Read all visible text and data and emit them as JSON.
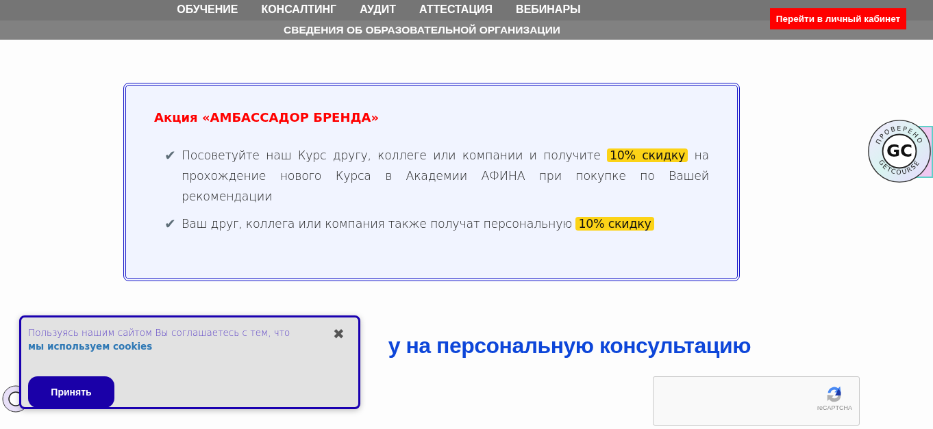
{
  "nav": {
    "items": [
      "ОБУЧЕНИЕ",
      "КОНСАЛТИНГ",
      "АУДИТ",
      "АТТЕСТАЦИЯ",
      "ВЕБИНАРЫ"
    ],
    "secondary": "СВЕДЕНИЯ ОБ ОБРАЗОВАТЕЛЬНОЙ ОРГАНИЗАЦИИ",
    "cabinet_button": "Перейти в личный кабинет"
  },
  "promo": {
    "title": "Акция «АМБАССАДОР БРЕНДА»",
    "items": [
      {
        "check": "✔",
        "text": "Посоветуйте наш Курс другу, коллеге или компании и получите **10% скидку** на прохождение нового Курса в Академии АФИНА при покупке по Вашей рекомендации"
      },
      {
        "check": "✔",
        "text": "Ваш друг, коллега или компания также получат персональную **10% скидку**"
      }
    ]
  },
  "badge": {
    "top": "ПРОВЕРЕНО",
    "logo": "GC",
    "bottom": "GETCOURSE"
  },
  "heading": "у на персональную консультацию",
  "captcha": {
    "label": "reCAPTCHA"
  },
  "cookie": {
    "text": "Пользуясь нашим сайтом Вы соглашаетесь с тем, что **мы используем cookies**",
    "close": "✖",
    "accept": "Принять"
  }
}
